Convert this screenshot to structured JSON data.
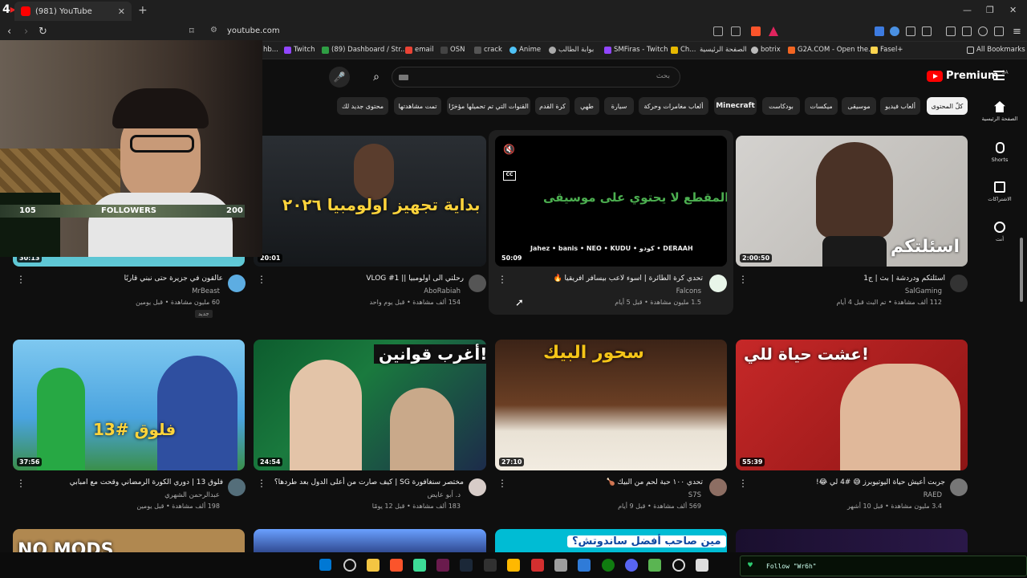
{
  "browser": {
    "tab_title": "(981) YouTube",
    "url": "youtube.com",
    "bookmarks": [
      {
        "label": "hb...",
        "color": "#888888"
      },
      {
        "label": "Twitch",
        "color": "#9146ff"
      },
      {
        "label": "(89) Dashboard / Str...",
        "color": "#2f9e44"
      },
      {
        "label": "email",
        "color": "#ea4335"
      },
      {
        "label": "OSN",
        "color": "#444444"
      },
      {
        "label": "crack",
        "color": "#555555"
      },
      {
        "label": "Anime",
        "color": "#4fc3f7"
      },
      {
        "label": "بوابة الطالب",
        "color": "#aaaaaa"
      },
      {
        "label": "SMFiras - Twitch",
        "color": "#9146ff"
      },
      {
        "label": "Ch...",
        "color": "#e6b800"
      },
      {
        "label": "الصفحة الرئيسية",
        "color": "#333333"
      },
      {
        "label": "botrix",
        "color": "#bbbbbb"
      },
      {
        "label": "G2A.COM - Open the...",
        "color": "#f26522"
      },
      {
        "label": "Fasel+",
        "color": "#ffd54f"
      }
    ],
    "all_bookmarks": "All Bookmarks"
  },
  "youtube": {
    "search_placeholder": "بحث",
    "logo_text": "Premium",
    "region": "SA",
    "chips": [
      "كلّ المحتوى",
      "ألعاب فيديو",
      "موسيقى",
      "ميكسات",
      "بودكاست",
      "Minecraft",
      "ألعاب مغامرات وحركة",
      "سيارة",
      "طهي",
      "كرة القدم",
      "القنوات التي تم تحميلها مؤخرًا",
      "تمت مشاهدتها",
      "محتوى جديد لك"
    ],
    "guide": [
      {
        "label": "الصفحة الرئيسية",
        "icon": "home-icon"
      },
      {
        "label": "Shorts",
        "icon": "shorts-icon"
      },
      {
        "label": "الاشتراكات",
        "icon": "subscriptions-icon"
      },
      {
        "label": "أنت",
        "icon": "you-icon"
      }
    ],
    "videos": [
      {
        "title": "اسئلتكم ودردشة | بث | ج1",
        "channel": "SalGaming",
        "meta": "112 ألف مشاهدة • تم البث قبل 4 أيام",
        "duration": "2:00:50",
        "overlay": "اسئلتكم"
      },
      {
        "title": "تحدي كرة الطائرة | اسوء لاعب بيسافر افريقيا 🔥",
        "channel": "Falcons",
        "meta": "1.5 مليون مشاهدة • قبل 5 أيام",
        "duration": "50:09",
        "overlay": "المقطع لا يحتوي على موسيقى",
        "sponsors": "Jahez • banis • NEO • KUDU • كودو • DERAAH"
      },
      {
        "title": "رحلتي الى اولومبيا || VLOG #1",
        "channel": "AboRabiah",
        "meta": "154 ألف مشاهدة • قبل يوم واحد",
        "duration": "20:01",
        "overlay": "بداية تجهيز اولومبيا ٢٠٢٦"
      },
      {
        "title": "عالقون في جزيرة حتى نبني قاربًا",
        "channel": "MrBeast",
        "meta": "60 مليون مشاهدة • قبل يومين",
        "duration": "30:13",
        "badge": "جديد"
      },
      {
        "title": "جربت أعيش حياة اليوتيوبرز 😅 #4 لي 😂!",
        "channel": "RAED",
        "meta": "3.4 مليون مشاهدة • قبل 10 أشهر",
        "duration": "55:39",
        "overlay": "عشت حياة للي!"
      },
      {
        "title": "تحدي ١٠٠ حبة لحم من البيك 🍗",
        "channel": "S7S",
        "meta": "569 ألف مشاهدة • قبل 9 أيام",
        "duration": "27:10",
        "overlay": "سحور البيك"
      },
      {
        "title": "مختصر سنغافورة SG | كيف صارت من أعلى الدول بعد طردها؟",
        "channel": "د. أبو عايض",
        "meta": "183 ألف مشاهدة • قبل 12 يومًا",
        "duration": "24:54",
        "overlay": "أغرب قوانين!"
      },
      {
        "title": "فلوق 13 | دوري الكورة الرمضاني وقحت مع امبابي",
        "channel": "عبدالرحمن الشهري",
        "meta": "198 ألف مشاهدة • قبل يومين",
        "duration": "37:56",
        "overlay": "فلوق #13"
      },
      {
        "overlay": "مين صاحب أفضل ساندوتش؟"
      },
      {
        "overlay": "NO MODS"
      }
    ]
  },
  "stream": {
    "followers_left": "105",
    "followers_label": "FOLLOWERS",
    "followers_right": "200",
    "follow_alert": "Follow \"Wr6h\""
  },
  "colors": {
    "background": "#0f0f0f",
    "accent": "#ff0000",
    "chip": "#272727"
  }
}
